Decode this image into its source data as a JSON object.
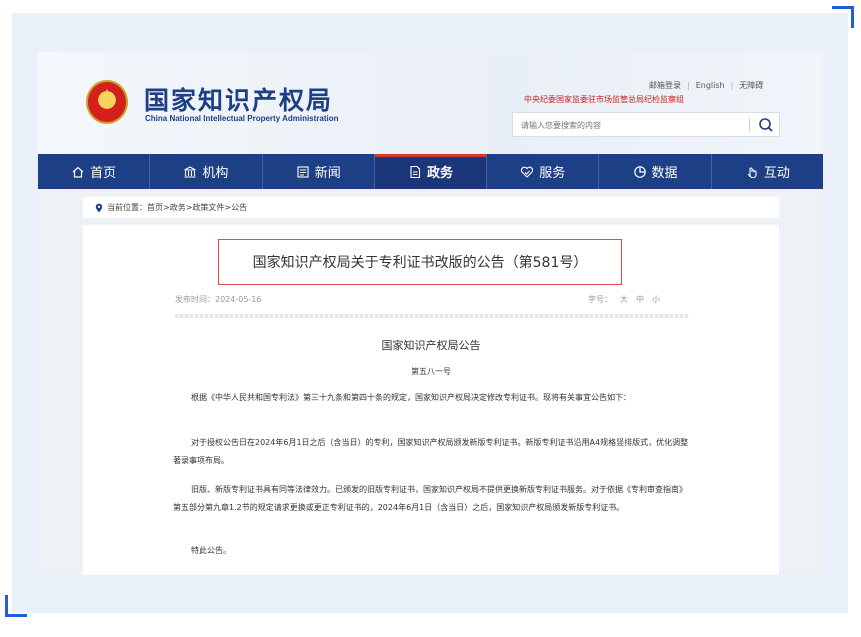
{
  "header": {
    "title_cn": "国家知识产权局",
    "title_en": "China National Intellectual Property Administration",
    "links": [
      "邮箱登录",
      "English",
      "无障碍"
    ],
    "supervision": "中央纪委国家监委驻市场监管总局纪检监察组",
    "search_placeholder": "请输入您要搜索的内容"
  },
  "nav": {
    "items": [
      {
        "label": "首页",
        "icon": "home-icon"
      },
      {
        "label": "机构",
        "icon": "institution-icon"
      },
      {
        "label": "新闻",
        "icon": "news-icon"
      },
      {
        "label": "政务",
        "icon": "document-icon",
        "active": true
      },
      {
        "label": "服务",
        "icon": "service-icon"
      },
      {
        "label": "数据",
        "icon": "pie-chart-icon"
      },
      {
        "label": "互动",
        "icon": "hand-icon"
      }
    ]
  },
  "breadcrumb": "当前位置：首页>政务>政策文件>公告",
  "article": {
    "title": "国家知识产权局关于专利证书改版的公告（第581号）",
    "publish_date": "发布时间：2024-05-16",
    "font_size_label": "字号：",
    "font_sizes": [
      "大",
      "中",
      "小"
    ],
    "heading": "国家知识产权局公告",
    "number": "第五八一号",
    "paragraphs": [
      "根据《中华人民共和国专利法》第三十九条和第四十条的规定，国家知识产权局决定修改专利证书。现将有关事宜公告如下：",
      "对于授权公告日在2024年6月1日之后（含当日）的专利，国家知识产权局颁发新版专利证书。新版专利证书沿用A4规格竖排版式，优化调整著录事项布局。",
      "旧版、新版专利证书具有同等法律效力。已颁发的旧版专利证书，国家知识产权局不提供更换新版专利证书服务。对于依据《专利审查指南》第五部分第九章1.2节的规定请求更换或更正专利证书的，2024年6月1日（含当日）之后，国家知识产权局颁发新版专利证书。",
      "特此公告。"
    ]
  },
  "colors": {
    "nav_bg": "#1d3f86",
    "accent_red": "#d43a2a",
    "title_border": "#e04a4a",
    "frame_bg": "#e9f0f9"
  }
}
